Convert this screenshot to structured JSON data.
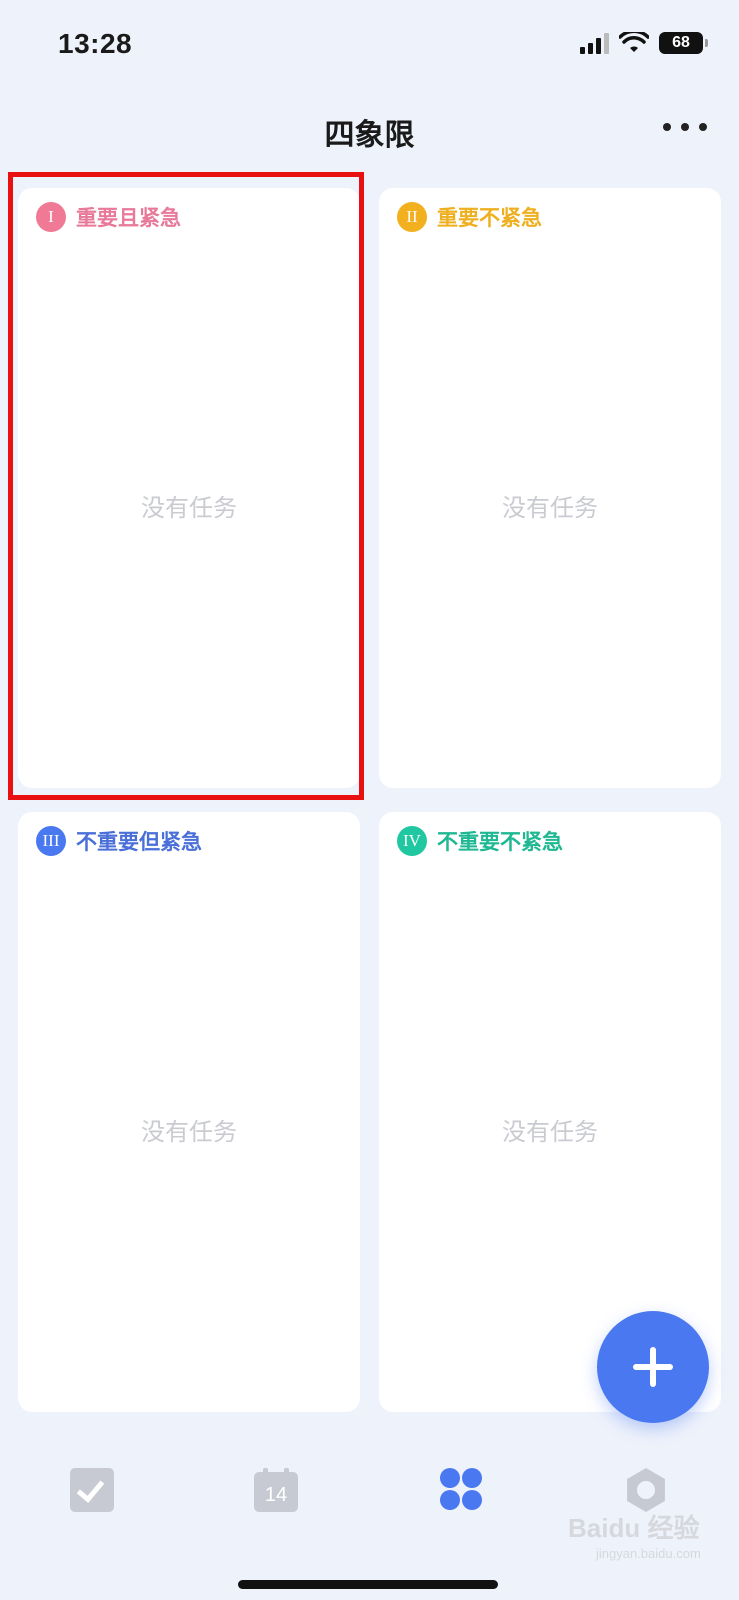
{
  "status_bar": {
    "time": "13:28",
    "battery": "68"
  },
  "header": {
    "title": "四象限"
  },
  "quadrants": [
    {
      "numeral": "I",
      "label": "重要且紧急",
      "empty_text": "没有任务",
      "color": "#f07a96"
    },
    {
      "numeral": "II",
      "label": "重要不紧急",
      "empty_text": "没有任务",
      "color": "#f2b01e"
    },
    {
      "numeral": "III",
      "label": "不重要但紧急",
      "empty_text": "没有任务",
      "color": "#4a78f0"
    },
    {
      "numeral": "IV",
      "label": "不重要不紧急",
      "empty_text": "没有任务",
      "color": "#1fc8a0"
    }
  ],
  "tabbar": {
    "calendar_day": "14",
    "active_tab": "quadrant"
  },
  "watermark": {
    "main": "Baidu 经验",
    "sub": "jingyan.baidu.com"
  },
  "colors": {
    "accent": "#4a78f0",
    "highlight_border": "#e81010"
  }
}
